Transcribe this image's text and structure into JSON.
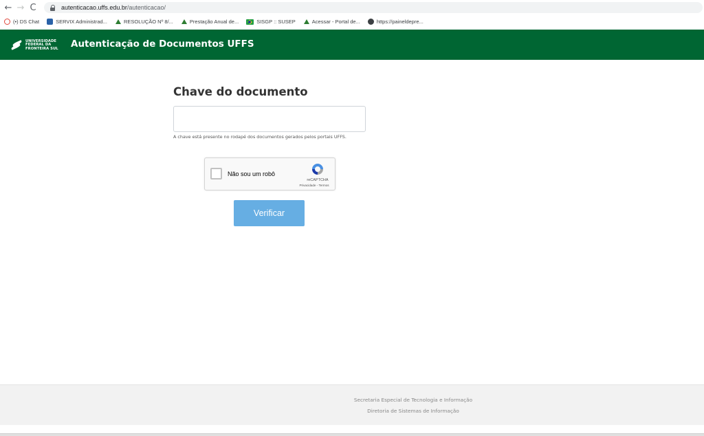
{
  "browser": {
    "back_glyph": "←",
    "forward_glyph": "→",
    "reload_glyph": "C",
    "url_host": "autenticacao.uffs.edu.br",
    "url_path": "/autenticacao/",
    "bookmarks": [
      {
        "label": "(•) DS Chat",
        "icon": "chat-icon"
      },
      {
        "label": "SERVIX Administrad...",
        "icon": "servix-icon"
      },
      {
        "label": "RESOLUÇÃO Nº 8/...",
        "icon": "uffs-icon"
      },
      {
        "label": "Prestação Anual de...",
        "icon": "uffs-icon"
      },
      {
        "label": "SISGP :: SUSEP",
        "icon": "brazil-flag-icon"
      },
      {
        "label": "Acessar - Portal de...",
        "icon": "uffs-icon"
      },
      {
        "label": "https://paineldepre...",
        "icon": "globe-icon"
      }
    ]
  },
  "header": {
    "logo_lines": [
      "UNIVERSIDADE",
      "FEDERAL DA",
      "FRONTEIRA SUL"
    ],
    "title": "Autenticação de Documentos UFFS",
    "background_color": "#006633"
  },
  "form": {
    "heading": "Chave do documento",
    "key_value": "",
    "key_placeholder": "",
    "help_text": "A chave está presente no rodapé dos documentos gerados pelos portais UFFS.",
    "captcha_label": "Não sou um robô",
    "captcha_brand": "reCAPTCHA",
    "captcha_terms": "Privacidade - Termos",
    "verify_label": "Verificar",
    "verify_color": "#66aee3"
  },
  "footer": {
    "line1": "Secretaria Especial de Tecnologia e Informação",
    "line2": "Diretoria de Sistemas de Informação"
  }
}
